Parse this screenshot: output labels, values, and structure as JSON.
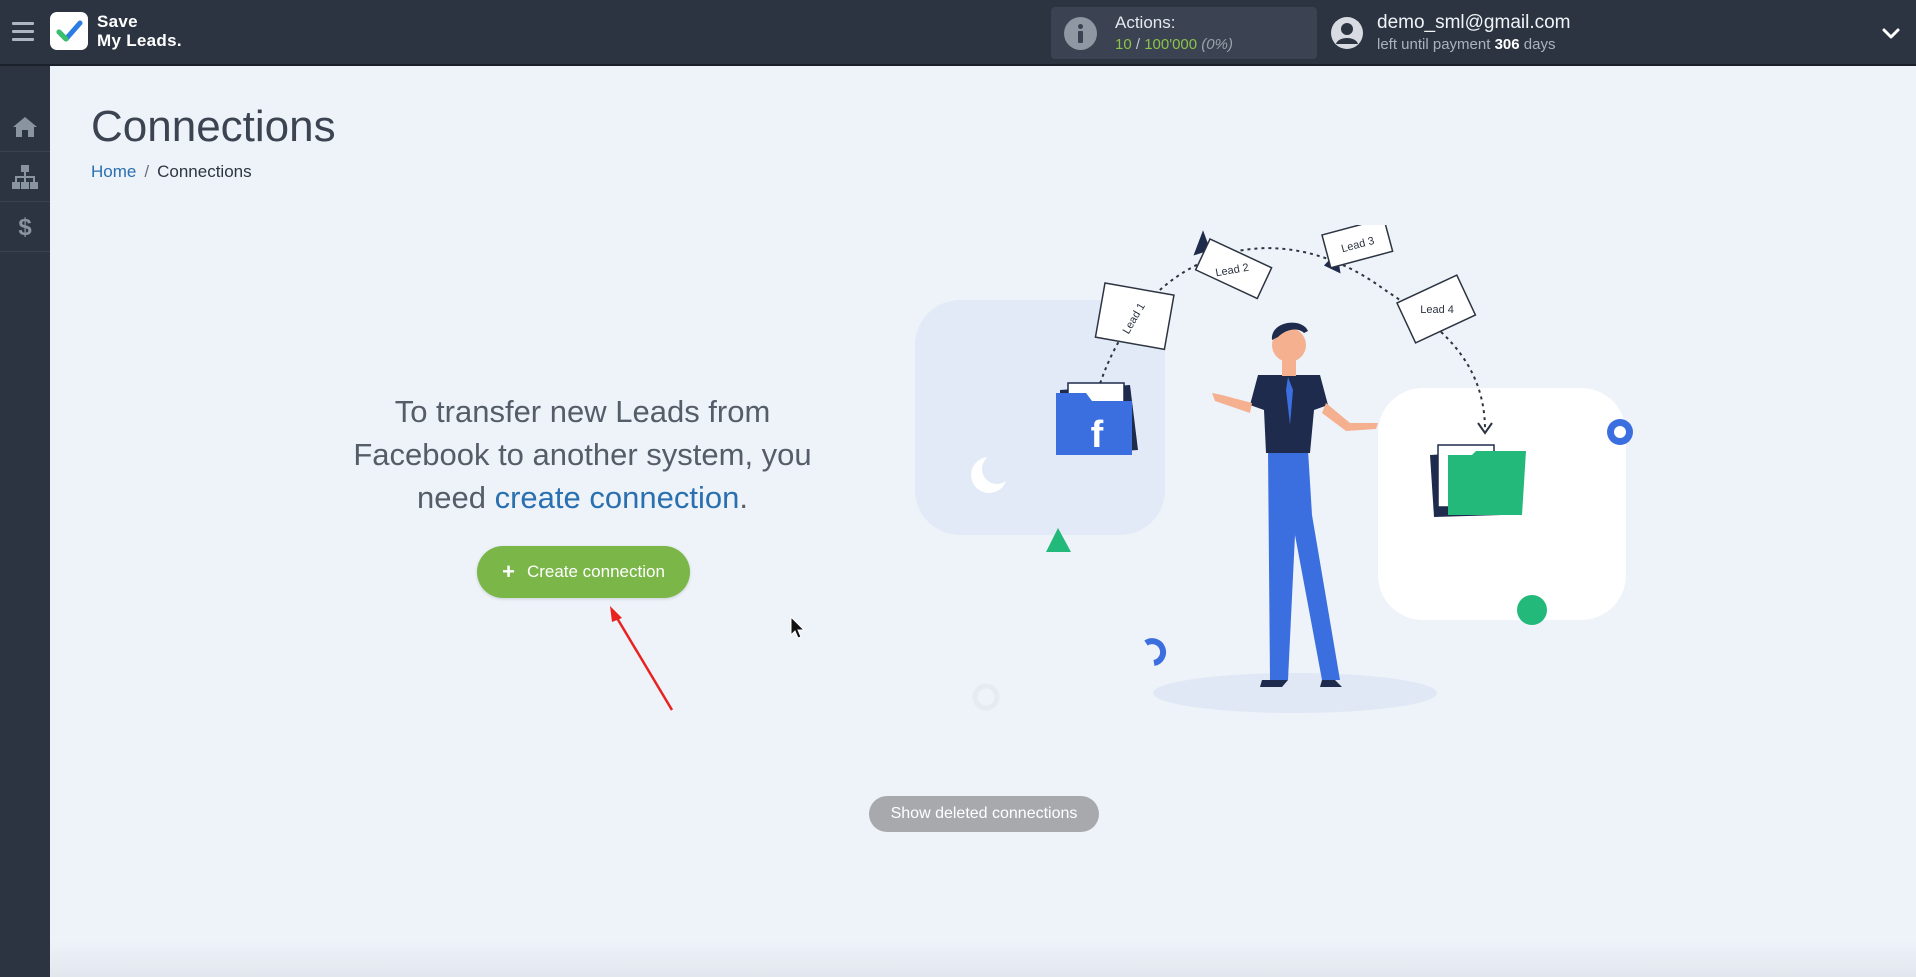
{
  "app": {
    "logo_line1": "Save",
    "logo_line2": "My Leads."
  },
  "header": {
    "actions_label": "Actions:",
    "actions_used": "10",
    "actions_separator": " / ",
    "actions_total": "100'000",
    "actions_percent": "(0%)",
    "user_email": "demo_sml@gmail.com",
    "payment_prefix": "left until payment ",
    "payment_days": "306",
    "payment_suffix": " days"
  },
  "sidebar": {
    "items": [
      {
        "icon": "home-icon"
      },
      {
        "icon": "sitemap-icon"
      },
      {
        "icon": "dollar-icon"
      }
    ]
  },
  "page": {
    "title": "Connections",
    "breadcrumb_home": "Home",
    "breadcrumb_sep": "/",
    "breadcrumb_current": "Connections",
    "intro_line1": "To transfer new Leads from",
    "intro_line2": "Facebook to another system, you",
    "intro_line3_prefix": "need ",
    "intro_link": "create connection",
    "intro_line3_suffix": ".",
    "create_button_label": "Create connection",
    "show_deleted_label": "Show deleted connections"
  },
  "illustration": {
    "leads": [
      "Lead 1",
      "Lead 2",
      "Lead 3",
      "Lead 4"
    ],
    "source_letter": "f"
  },
  "colors": {
    "topbar": "#2c3441",
    "accent_green": "#7ab648",
    "link_blue": "#2a6fb0",
    "facebook_blue": "#3b6fe0",
    "folder_green": "#23b97a"
  }
}
